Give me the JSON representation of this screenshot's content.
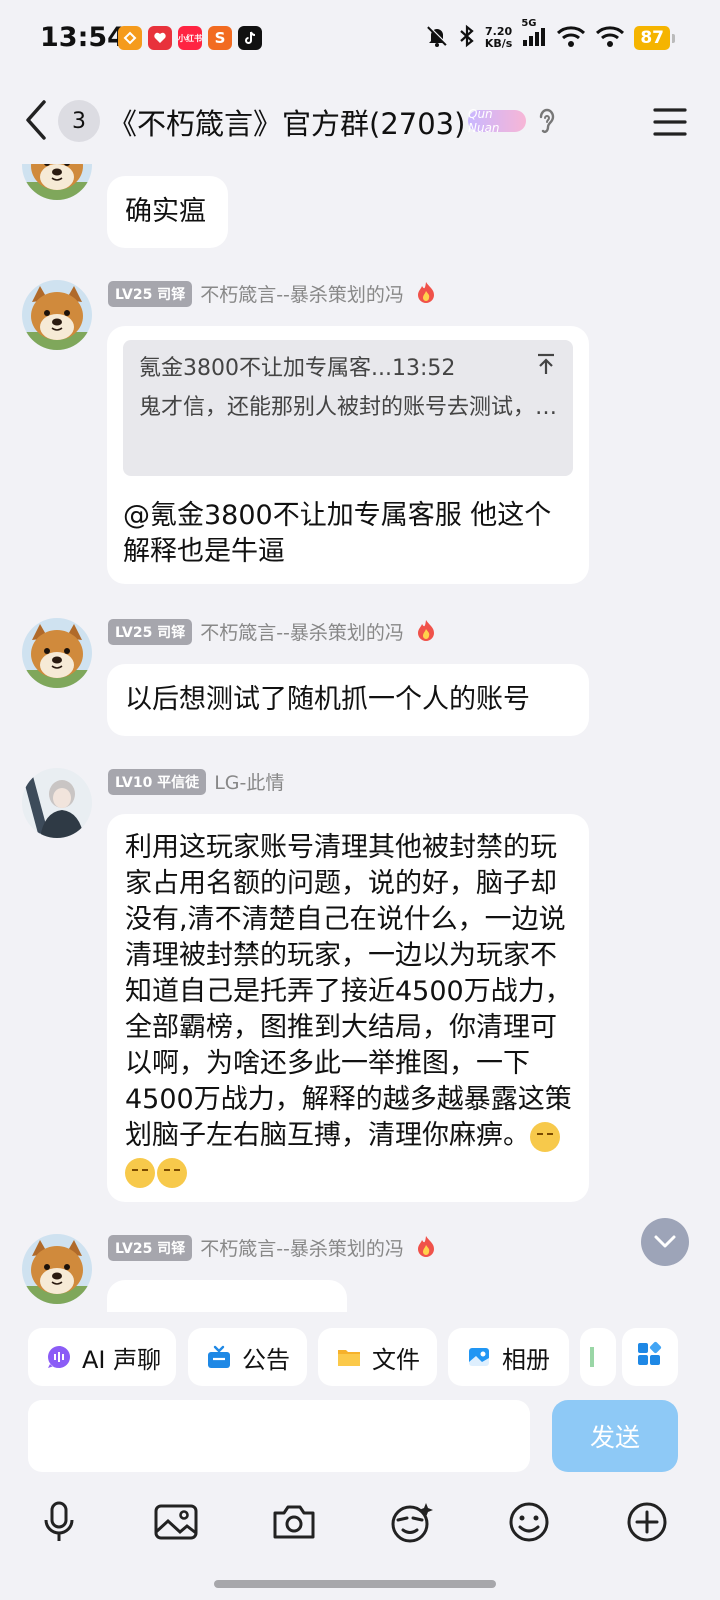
{
  "status_bar": {
    "time": "13:54",
    "net_speed_value": "7.20",
    "net_speed_unit": "KB/s",
    "network_type": "5G",
    "battery": "87",
    "notification_icons": [
      "app-orange-icon",
      "app-red-icon",
      "app-red-mall-icon",
      "app-orange-s-icon",
      "tiktok-icon"
    ],
    "notif_labels": [
      "",
      "",
      "小红书",
      "S",
      ""
    ]
  },
  "header": {
    "unread_count": "3",
    "title": "《不朽箴言》官方群(2703)",
    "badge_text": "Qun Nuan"
  },
  "messages": [
    {
      "id": "m1",
      "avatar": "shiba-avatar",
      "text": "确实瘟"
    },
    {
      "id": "m2",
      "avatar": "shiba-avatar",
      "level": "LV25 司铎",
      "sender": "不朽箴言--暴杀策划的冯",
      "quote": {
        "author_time": "氪金3800不让加专属客...13:52",
        "text": "鬼才信，还能那别人被封的账号去测试，…"
      },
      "text": "@氪金3800不让加专属客服 他这个解释也是牛逼"
    },
    {
      "id": "m3",
      "avatar": "shiba-avatar",
      "level": "LV25 司铎",
      "sender": "不朽箴言--暴杀策划的冯",
      "text": "以后想测试了随机抓一个人的账号"
    },
    {
      "id": "m4",
      "avatar": "anime-avatar",
      "level": "LV10 平信徒",
      "sender": "LG-此情",
      "text": "利用这玩家账号清理其他被封禁的玩家占用名额的问题，说的好，脑子却没有,清不清楚自己在说什么，一边说清理被封禁的玩家，一边以为玩家不知道自己是托弄了接近4500万战力，全部霸榜，图推到大结局，你清理可以啊，为啥还多此一举推图，一下4500万战力，解释的越多越暴露这策划脑子左右脑互搏，清理你麻痹。",
      "emoji_count": 3
    },
    {
      "id": "m5",
      "avatar": "shiba-avatar",
      "level": "LV25 司铎",
      "sender": "不朽箴言--暴杀策划的冯"
    }
  ],
  "quick_actions": [
    {
      "label": "AI 声聊",
      "icon": "ai-voice-icon"
    },
    {
      "label": "公告",
      "icon": "announcement-icon"
    },
    {
      "label": "文件",
      "icon": "folder-icon"
    },
    {
      "label": "相册",
      "icon": "album-icon"
    }
  ],
  "composer": {
    "placeholder": "",
    "send_label": "发送"
  },
  "toolbar": [
    "microphone-icon",
    "image-icon",
    "camera-icon",
    "sticker-face-icon",
    "emoji-icon",
    "plus-icon"
  ],
  "colors": {
    "background": "#f2f2f6",
    "bubble": "#ffffff",
    "level_badge": "#a6a6ad",
    "send_button": "#8ec9f6",
    "battery": "#f5b400"
  }
}
